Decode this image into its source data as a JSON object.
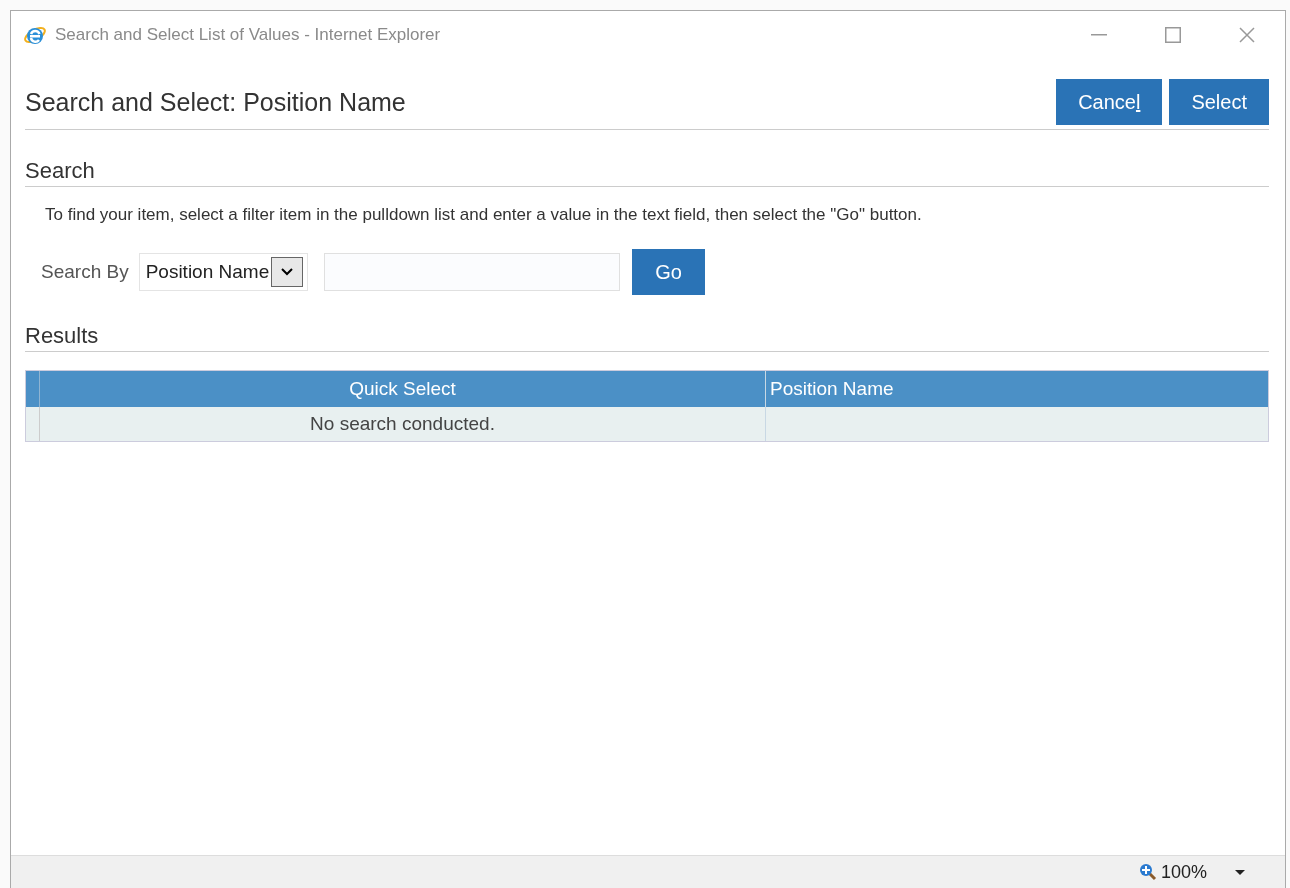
{
  "window": {
    "title": "Search and Select List of Values - Internet Explorer"
  },
  "header": {
    "title": "Search and Select: Position Name",
    "buttons": [
      {
        "label": "Cancel",
        "access_key_last_letter": true
      },
      {
        "label": "Select",
        "access_key_last_letter": false
      }
    ]
  },
  "search": {
    "heading": "Search",
    "instructions": "To find your item, select a filter item in the pulldown list and enter a value in the text field, then select the \"Go\" button.",
    "label": "Search By",
    "filter": "Position Name",
    "go": "Go"
  },
  "results": {
    "heading": "Results",
    "columns": [
      "Quick Select",
      "Position Name"
    ],
    "message": "No search conducted."
  },
  "status_bar": {
    "zoom": "100%"
  }
}
